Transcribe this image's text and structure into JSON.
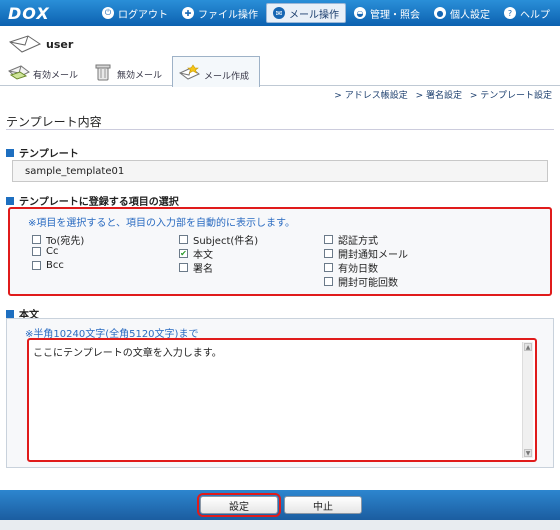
{
  "app": {
    "logo": "DOX"
  },
  "nav": {
    "items": [
      {
        "icon": "logout-icon",
        "label": "ログアウト"
      },
      {
        "icon": "file-icon",
        "label": "ファイル操作"
      },
      {
        "icon": "mail-icon",
        "label": "メール操作",
        "active": true
      },
      {
        "icon": "admin-icon",
        "label": "管理・照会"
      },
      {
        "icon": "person-icon",
        "label": "個人設定"
      },
      {
        "icon": "help-icon",
        "label": "ヘルプ"
      }
    ]
  },
  "user": {
    "name": "user"
  },
  "tabs": [
    {
      "label": "有効メール"
    },
    {
      "label": "無効メール"
    },
    {
      "label": "メール作成",
      "active": true
    }
  ],
  "breadcrumbs": [
    "> アドレス帳設定",
    "> 署名設定",
    "> テンプレート設定"
  ],
  "page": {
    "title": "テンプレート内容"
  },
  "template": {
    "heading": "テンプレート",
    "value": "sample_template01"
  },
  "fields": {
    "heading": "テンプレートに登録する項目の選択",
    "note": "※項目を選択すると、項目の入力部を自動的に表示します。",
    "items": [
      {
        "label": "To(宛先)",
        "checked": false
      },
      {
        "label": "Cc",
        "checked": false
      },
      {
        "label": "Bcc",
        "checked": false
      },
      {
        "label": "Subject(件名)",
        "checked": false
      },
      {
        "label": "本文",
        "checked": true
      },
      {
        "label": "署名",
        "checked": false
      },
      {
        "label": "認証方式",
        "checked": false
      },
      {
        "label": "開封通知メール",
        "checked": false
      },
      {
        "label": "有効日数",
        "checked": false
      },
      {
        "label": "開封可能回数",
        "checked": false
      }
    ]
  },
  "body": {
    "heading": "本文",
    "limit": "※半角10240文字(全角5120文字)まで",
    "text": "ここにテンプレートの文章を入力します。"
  },
  "actions": {
    "save_label": "設定",
    "cancel_label": "中止"
  },
  "colors": {
    "nav": "#1666b3",
    "highlight": "#e01b1b",
    "note": "#2a6bc1"
  }
}
